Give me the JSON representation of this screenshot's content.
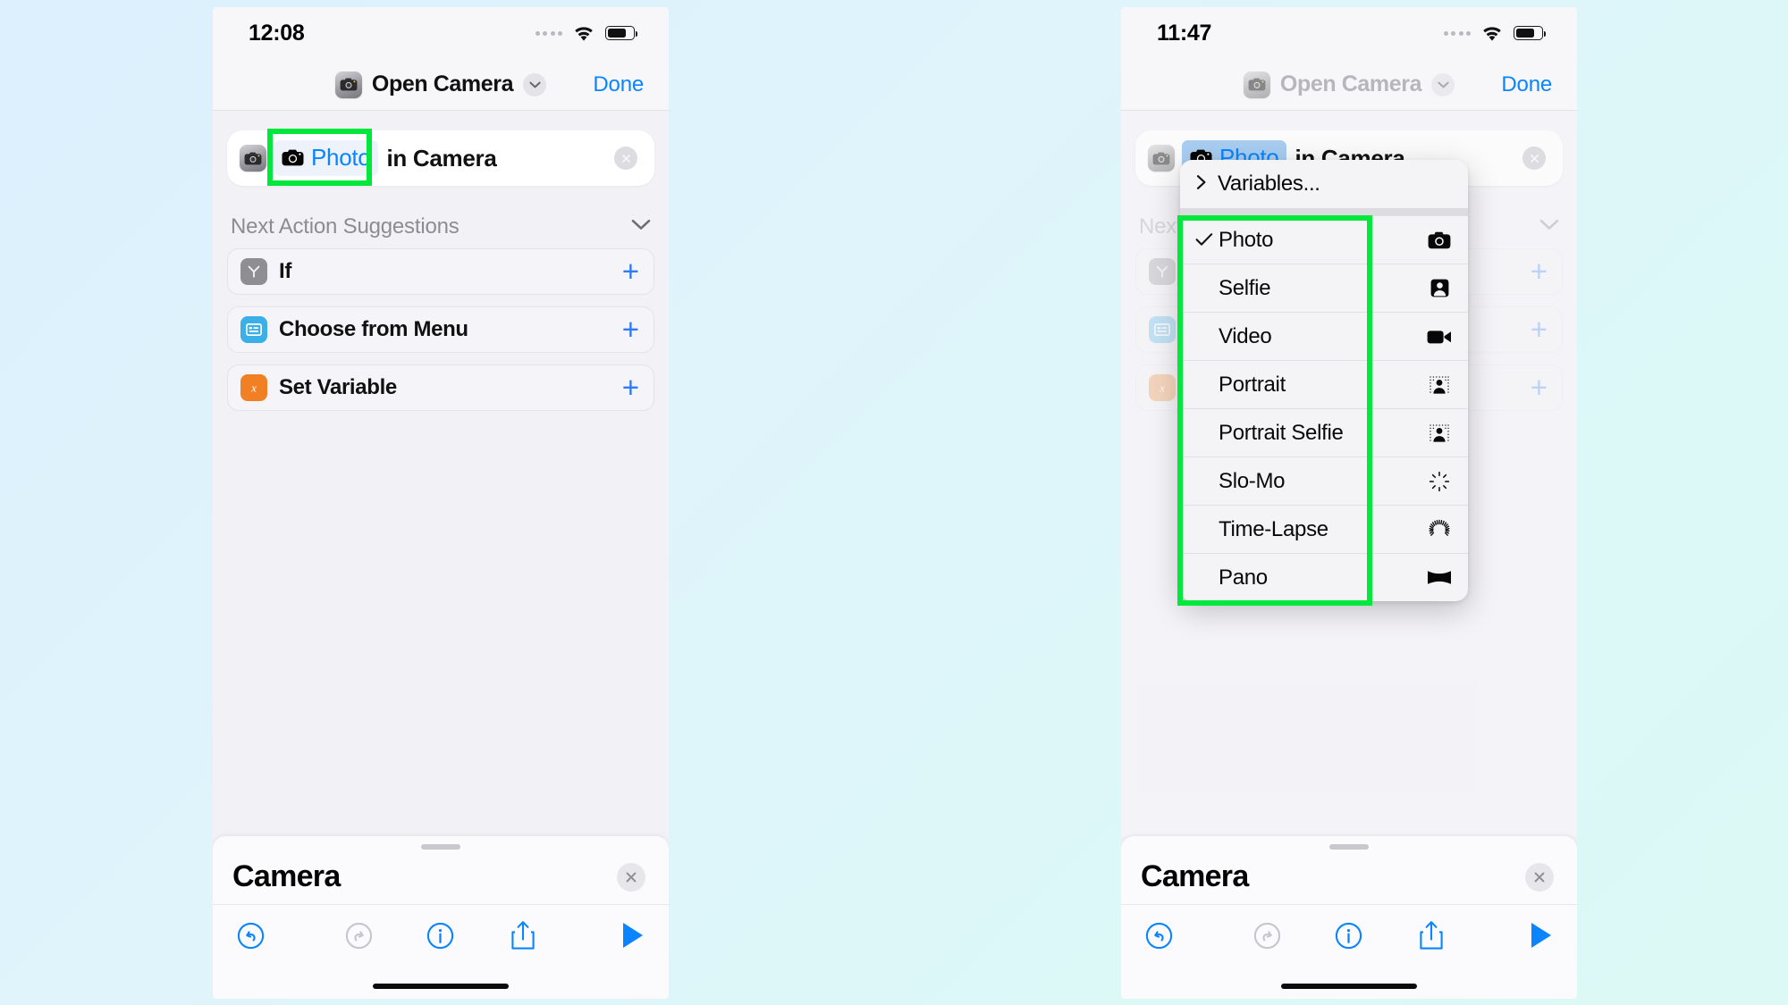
{
  "theme": {
    "accent_blue": "#0a84ff",
    "highlight_green": "#00e83c",
    "orange": "#f08023",
    "cyan": "#3aafe8",
    "grey_icon": "#8e8e93",
    "bg_gradient_from": "#dcf0fd",
    "bg_gradient_to": "#ddf9f6"
  },
  "left_phone": {
    "status": {
      "time": "12:08",
      "signal_icon": "signal-dots-icon",
      "wifi_icon": "wifi-icon",
      "battery_icon": "battery-icon"
    },
    "nav": {
      "app_icon": "camera-app-icon",
      "title": "Open Camera",
      "chevron_icon": "chevron-down-icon",
      "done_label": "Done"
    },
    "action": {
      "app_icon": "camera-app-icon",
      "token_icon": "camera-icon",
      "token_label": "Photo",
      "rest_text": "in Camera",
      "clear_icon": "clear-circle-icon"
    },
    "suggestions": {
      "title": "Next Action Suggestions",
      "collapse_icon": "chevron-down-icon",
      "items": [
        {
          "label": "If",
          "icon": "branch-icon",
          "icon_color": "#8e8e93",
          "add_icon": "plus-icon"
        },
        {
          "label": "Choose from Menu",
          "icon": "menu-list-icon",
          "icon_color": "#3aafe8",
          "add_icon": "plus-icon"
        },
        {
          "label": "Set Variable",
          "icon": "variable-x-icon",
          "icon_color": "#f08023",
          "add_icon": "plus-icon"
        }
      ]
    },
    "sheet": {
      "grabber": "sheet-grabber",
      "title": "Camera",
      "close_icon": "close-circle-icon",
      "tools": [
        {
          "name": "undo-button",
          "icon": "undo-icon",
          "enabled": true
        },
        {
          "name": "redo-button",
          "icon": "redo-icon",
          "enabled": false
        },
        {
          "name": "info-button",
          "icon": "info-icon",
          "enabled": true
        },
        {
          "name": "share-button",
          "icon": "share-icon",
          "enabled": true
        },
        {
          "name": "run-button",
          "icon": "play-icon",
          "enabled": true
        }
      ]
    }
  },
  "right_phone": {
    "status": {
      "time": "11:47",
      "signal_icon": "signal-dots-icon",
      "wifi_icon": "wifi-icon",
      "battery_icon": "battery-icon"
    },
    "nav": {
      "app_icon": "camera-app-icon",
      "title": "Open Camera",
      "chevron_icon": "chevron-down-icon",
      "done_label": "Done"
    },
    "action": {
      "app_icon": "camera-app-icon",
      "token_icon": "camera-icon",
      "token_label": "Photo",
      "rest_text": "in Camera",
      "clear_icon": "clear-circle-icon"
    },
    "suggestions": {
      "title": "Next",
      "collapse_icon": "chevron-down-icon",
      "items": [
        {
          "label": "",
          "icon": "branch-icon",
          "icon_color": "#8e8e93",
          "add_icon": "plus-icon"
        },
        {
          "label": "",
          "icon": "menu-list-icon",
          "icon_color": "#3aafe8",
          "add_icon": "plus-icon"
        },
        {
          "label": "",
          "icon": "variable-x-icon",
          "icon_color": "#f08023",
          "add_icon": "plus-icon"
        }
      ]
    },
    "menu": {
      "variables_label": "Variables...",
      "variables_chevron_icon": "chevron-right-icon",
      "items": [
        {
          "label": "Photo",
          "checked": true,
          "icon": "camera-icon"
        },
        {
          "label": "Selfie",
          "checked": false,
          "icon": "person-portrait-icon"
        },
        {
          "label": "Video",
          "checked": false,
          "icon": "video-camera-icon"
        },
        {
          "label": "Portrait",
          "checked": false,
          "icon": "portrait-depth-icon"
        },
        {
          "label": "Portrait Selfie",
          "checked": false,
          "icon": "portrait-depth-icon"
        },
        {
          "label": "Slo-Mo",
          "checked": false,
          "icon": "slomo-icon"
        },
        {
          "label": "Time-Lapse",
          "checked": false,
          "icon": "timelapse-icon"
        },
        {
          "label": "Pano",
          "checked": false,
          "icon": "panorama-icon"
        }
      ]
    },
    "sheet": {
      "grabber": "sheet-grabber",
      "title": "Camera",
      "close_icon": "close-circle-icon",
      "tools": [
        {
          "name": "undo-button",
          "icon": "undo-icon",
          "enabled": true
        },
        {
          "name": "redo-button",
          "icon": "redo-icon",
          "enabled": false
        },
        {
          "name": "info-button",
          "icon": "info-icon",
          "enabled": true
        },
        {
          "name": "share-button",
          "icon": "share-icon",
          "enabled": true
        },
        {
          "name": "run-button",
          "icon": "play-icon",
          "enabled": true
        }
      ]
    }
  },
  "annotations": {
    "left_highlight": "token-photo-highlight",
    "right_highlight": "menu-options-highlight"
  }
}
